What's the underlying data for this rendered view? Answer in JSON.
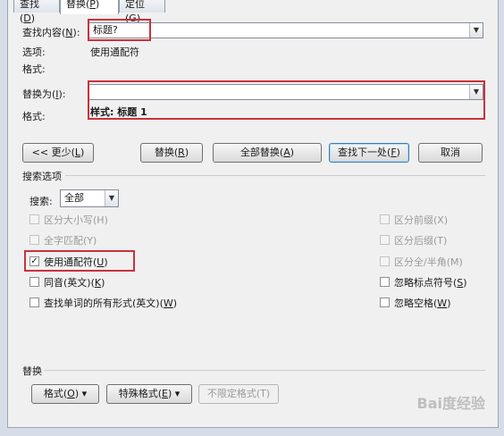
{
  "tabs": [
    {
      "label": "查找(",
      "key": "D",
      "end": ")"
    },
    {
      "label": "替换(",
      "key": "P",
      "end": ")"
    },
    {
      "label": "定位(",
      "key": "G",
      "end": ")"
    }
  ],
  "find": {
    "label": "查找内容(",
    "label_key": "N",
    "label_end": "):",
    "value": "标题?",
    "options_label": "选项:",
    "options_value": "使用通配符",
    "format_label": "格式:"
  },
  "replace": {
    "label": "替换为(",
    "label_key": "I",
    "label_end": "):",
    "value": "",
    "format_label": "格式:",
    "format_value": "样式: 标题 1"
  },
  "buttons": {
    "less": "<< 更少(",
    "less_key": "L",
    "less_end": ")",
    "replace": "替换(",
    "replace_key": "R",
    "replace_end": ")",
    "replace_all": "全部替换(",
    "replace_all_key": "A",
    "replace_all_end": ")",
    "find_next": "查找下一处(",
    "find_next_key": "F",
    "find_next_end": ")",
    "cancel": "取消"
  },
  "search_options": {
    "section_title": "搜索选项",
    "search_label": "搜索:",
    "search_value": "全部"
  },
  "left_options": [
    {
      "text": "区分大小写(H)",
      "checked": false,
      "disabled": true
    },
    {
      "text": "全字匹配(Y)",
      "checked": false,
      "disabled": true
    },
    {
      "text": "使用通配符(",
      "key": "U",
      "end": ")",
      "checked": true,
      "disabled": false
    },
    {
      "text": "同音(英文)(",
      "key": "K",
      "end": ")",
      "checked": false,
      "disabled": false
    },
    {
      "text": "查找单词的所有形式(英文)(",
      "key": "W",
      "end": ")",
      "checked": false,
      "disabled": false
    }
  ],
  "right_options": [
    {
      "text": "区分前缀(X)",
      "checked": false,
      "disabled": true
    },
    {
      "text": "区分后缀(T)",
      "checked": false,
      "disabled": true
    },
    {
      "text": "区分全/半角(M)",
      "checked": false,
      "disabled": true
    },
    {
      "text": "忽略标点符号(",
      "key": "S",
      "end": ")",
      "checked": false,
      "disabled": false
    },
    {
      "text": "忽略空格(",
      "key": "W",
      "end": ")",
      "checked": false,
      "disabled": false
    }
  ],
  "replace_section": {
    "title": "替换",
    "format_btn": "格式(",
    "format_key": "O",
    "format_end": ") ▾",
    "special_btn": "特殊格式(",
    "special_key": "E",
    "special_end": ") ▾",
    "no_format_btn": "不限定格式(T)"
  },
  "watermark": "Bai度经验"
}
